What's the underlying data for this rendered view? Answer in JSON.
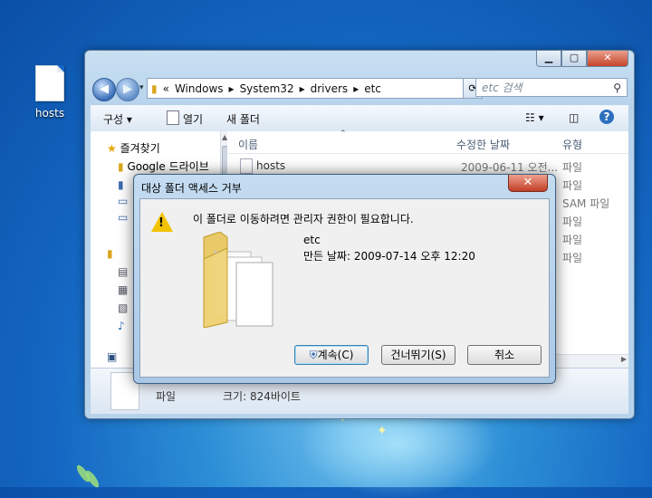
{
  "desktop": {
    "icon_label": "hosts"
  },
  "explorer": {
    "address_parts": [
      "«",
      "Windows",
      "▸",
      "System32",
      "▸",
      "drivers",
      "▸",
      "etc"
    ],
    "search_placeholder": "etc 검색",
    "toolbar": {
      "organize": "구성 ▾",
      "open": "열기",
      "new_folder": "새 폴더"
    },
    "nav_pane": {
      "favorites": "즐겨찾기",
      "google_drive": "Google 드라이브"
    },
    "columns": {
      "name": "이름",
      "modified": "수정한 날짜",
      "type": "유형"
    },
    "files": [
      {
        "name": "hosts",
        "date": "2009-06-11 오전...",
        "type": "파일"
      },
      {
        "name": "",
        "date": "",
        "type": "파일"
      },
      {
        "name": "",
        "date": "",
        "type": "SAM 파일"
      },
      {
        "name": "",
        "date": "",
        "type": "파일"
      },
      {
        "name": "",
        "date": "",
        "type": "파일"
      },
      {
        "name": "",
        "date": "",
        "type": "파일"
      }
    ],
    "details": {
      "type_label": "파일",
      "size_label": "크기: 824바이트"
    }
  },
  "dialog": {
    "title": "대상 폴더 액세스 거부",
    "message": "이 폴더로 이동하려면 관리자 권한이 필요합니다.",
    "folder_name": "etc",
    "created_date": "만든 날짜: 2009-07-14 오후 12:20",
    "buttons": {
      "continue": "계속(C)",
      "skip": "건너뛰기(S)",
      "cancel": "취소"
    }
  }
}
